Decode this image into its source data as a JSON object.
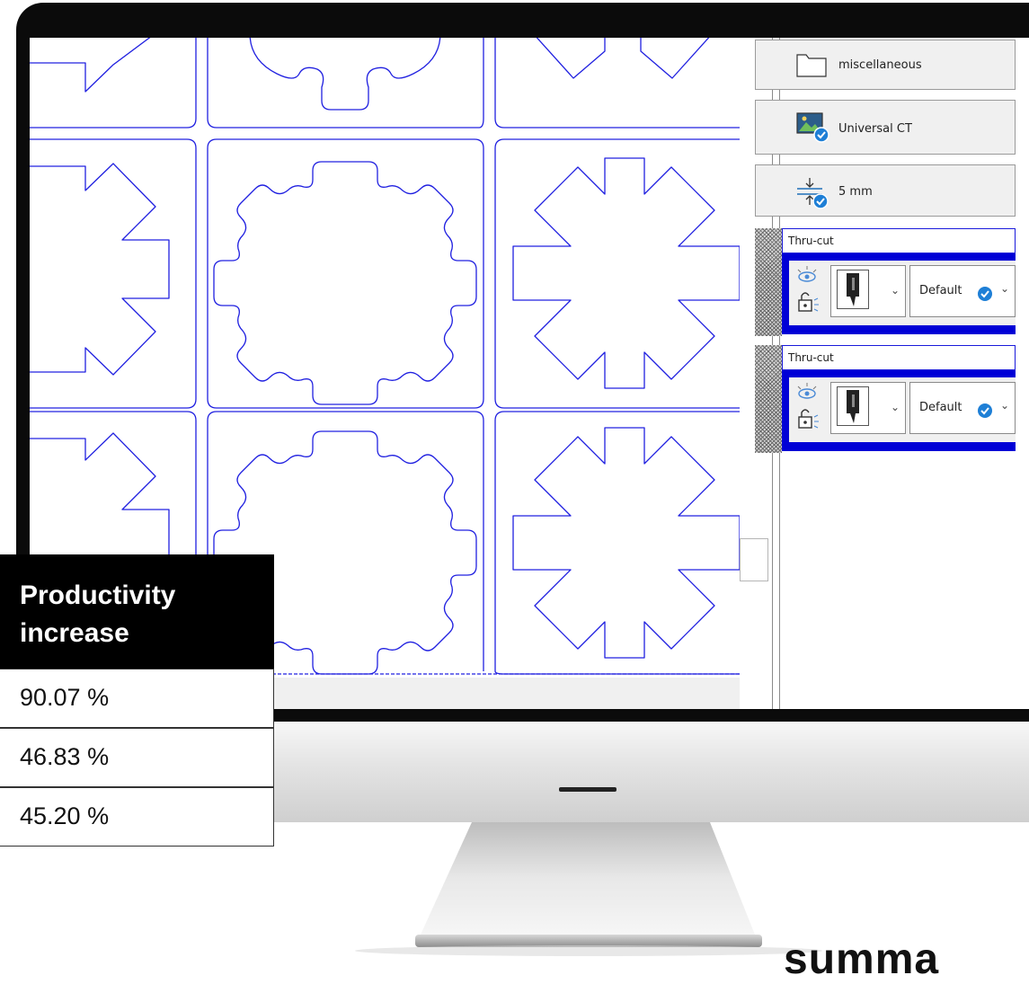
{
  "panel": {
    "material_folder": "miscellaneous",
    "media_profile": "Universal CT",
    "spacing": "5 mm"
  },
  "layers": [
    {
      "name": "Thru-cut",
      "method": "Default"
    },
    {
      "name": "Thru-cut",
      "method": "Default"
    }
  ],
  "productivity_table": {
    "header_line1": "Productivity",
    "header_line2": "increase",
    "rows": [
      "90.07 %",
      "46.83 %",
      "45.20 %"
    ]
  },
  "brand": {
    "text": "summa"
  },
  "colors": {
    "cut_line": "#2020e0",
    "layer_accent": "#0000d6",
    "header_bg": "#000000"
  },
  "icons": [
    "folder-icon",
    "image-check-icon",
    "spacing-check-icon",
    "visibility-icon",
    "lock-icon",
    "knife-tool-icon",
    "check-badge-icon",
    "chevron-down-icon"
  ]
}
